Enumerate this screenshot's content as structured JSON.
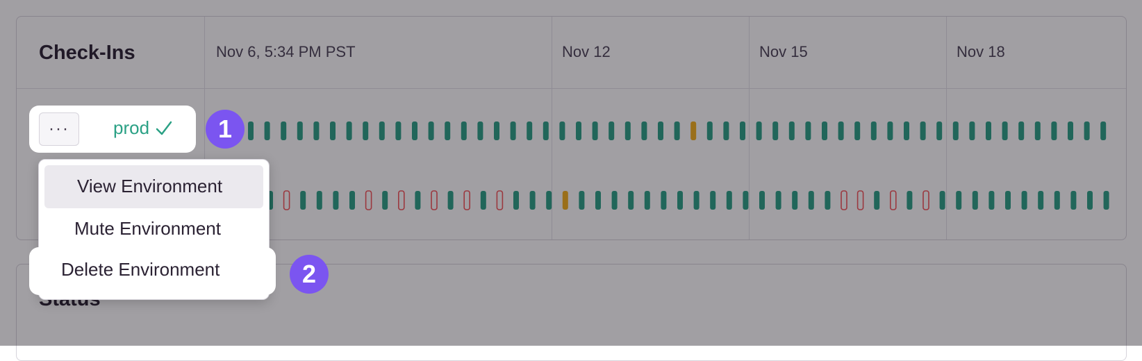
{
  "checkins": {
    "title": "Check-Ins",
    "time_labels": [
      "Nov 6, 5:34 PM PST",
      "Nov 12",
      "Nov 15",
      "Nov 18"
    ]
  },
  "status": {
    "title": "Status"
  },
  "environment": {
    "name": "prod",
    "status": "ok"
  },
  "menu": {
    "more_label": "···",
    "items": [
      "View Environment",
      "Mute Environment",
      "Delete Environment"
    ]
  },
  "badges": [
    "1",
    "2"
  ],
  "colors": {
    "ok": "#2ba185",
    "missed": "#f3b01b",
    "error": "#f55459",
    "accent": "#7b55f0"
  }
}
